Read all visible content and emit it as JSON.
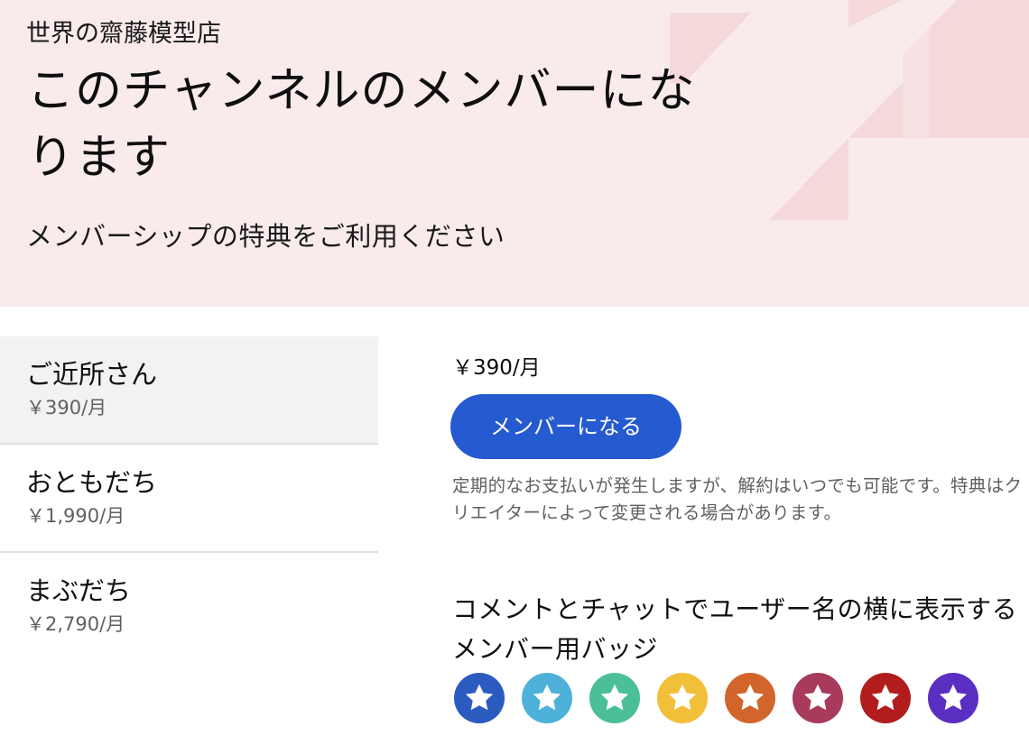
{
  "banner": {
    "channel_name": "世界の齋藤模型店",
    "title": "このチャンネルのメンバーになります",
    "subtitle": "メンバーシップの特典をご利用ください"
  },
  "tiers": [
    {
      "name": "ご近所さん",
      "price": "￥390/月",
      "selected": true
    },
    {
      "name": "おともだち",
      "price": "￥1,990/月",
      "selected": false
    },
    {
      "name": "まぶだち",
      "price": "￥2,790/月",
      "selected": false
    }
  ],
  "detail": {
    "price": "￥390/月",
    "join_label": "メンバーになる",
    "notice": "定期的なお支払いが発生しますが、解約はいつでも可能です。特典はクリエイターによって変更される場合があります。",
    "badge_heading": "コメントとチャットでユーザー名の横に表示するメンバー用バッジ"
  },
  "badges": [
    {
      "icon": "star-icon",
      "color": "#2b5bbf"
    },
    {
      "icon": "star-icon",
      "color": "#4db1d9"
    },
    {
      "icon": "star-icon",
      "color": "#4bbf98"
    },
    {
      "icon": "star-icon",
      "color": "#f2bf38"
    },
    {
      "icon": "star-icon",
      "color": "#d2652c"
    },
    {
      "icon": "star-icon",
      "color": "#a83a5c"
    },
    {
      "icon": "star-icon",
      "color": "#b11d1d"
    },
    {
      "icon": "star-icon",
      "color": "#5b2ec2"
    }
  ],
  "colors": {
    "banner_bg": "#f9ebec",
    "banner_shape": "#f4d6d7",
    "accent": "#255ad0",
    "selected_bg": "#f2f2f2"
  }
}
